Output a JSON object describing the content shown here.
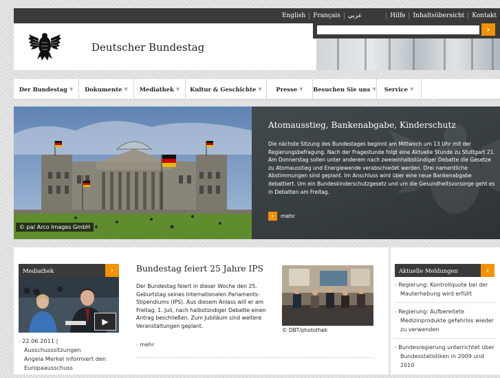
{
  "topbar": {
    "languages": [
      "English",
      "Français",
      "عربي"
    ],
    "links": [
      "Hilfe",
      "Inhaltsübersicht",
      "Kontakt"
    ]
  },
  "header": {
    "title": "Deutscher Bundestag"
  },
  "search": {
    "placeholder": "",
    "button_icon": "arrow-right-icon"
  },
  "nav": {
    "items": [
      "Der Bundestag",
      "Dokumente",
      "Mediathek",
      "Kultur & Geschichte",
      "Presse",
      "Besuchen Sie uns",
      "Service"
    ]
  },
  "hero": {
    "caption": "© pa/ Arco Images GmbH",
    "title": "Atomausstieg, Bankenabgabe, Kinderschutz",
    "body": "Die nächste Sitzung des Bundestages beginnt am Mittwoch um 13 Uhr mit der Regierungsbefragung. Nach der Fragestunde folgt eine Aktuelle Stunde zu Stuttgart 21. Am Donnerstag sollen unter anderem nach zweieinhalbstündiger Debatte die Gesetze zu Atomausstieg und Energiewende verabschiedet werden. Drei namentliche Abstimmungen sind geplant. Im Anschluss wird über eine neue Bankenabgabe debattiert. Um ein Bundeskinderschutzgesetz und um die Gesundheitsvorsorge geht es in Debatten am Freitag.",
    "more": "mehr"
  },
  "mediathek": {
    "heading": "Mediathek",
    "date": "22.06.2011 |",
    "category": "Ausschusssitzungen",
    "line1": "Angela Merkel informiert den",
    "line2": "Europaausschuss"
  },
  "article": {
    "title": "Bundestag feiert 25 Jahre IPS",
    "body": "Der Bundestag feiert in dieser Woche den 25. Geburtstag seines Internationalen Parlaments-Stipendiums (IPS). Aus diesem Anlass will er am Freitag, 1. Juli, nach halbstündiger Debatte einen Antrag beschließen. Zum Jubiläum sind weitere Veranstaltungen geplant.",
    "more": "mehr",
    "caption": "© DBT/photothek"
  },
  "news": {
    "heading": "Aktuelle Meldungen",
    "items": [
      "Regierung: Kontrollquote bei der Mauterhebung wird erfüllt",
      "Regierung: Aufbereitete Medizinprodukte gefahrlos wieder zu verwenden",
      "Bundesregierung unterrichtet über Bundesstatistiken in 2009 und 2010"
    ]
  },
  "colors": {
    "accent": "#f39200",
    "dark": "#3a3a3a"
  }
}
